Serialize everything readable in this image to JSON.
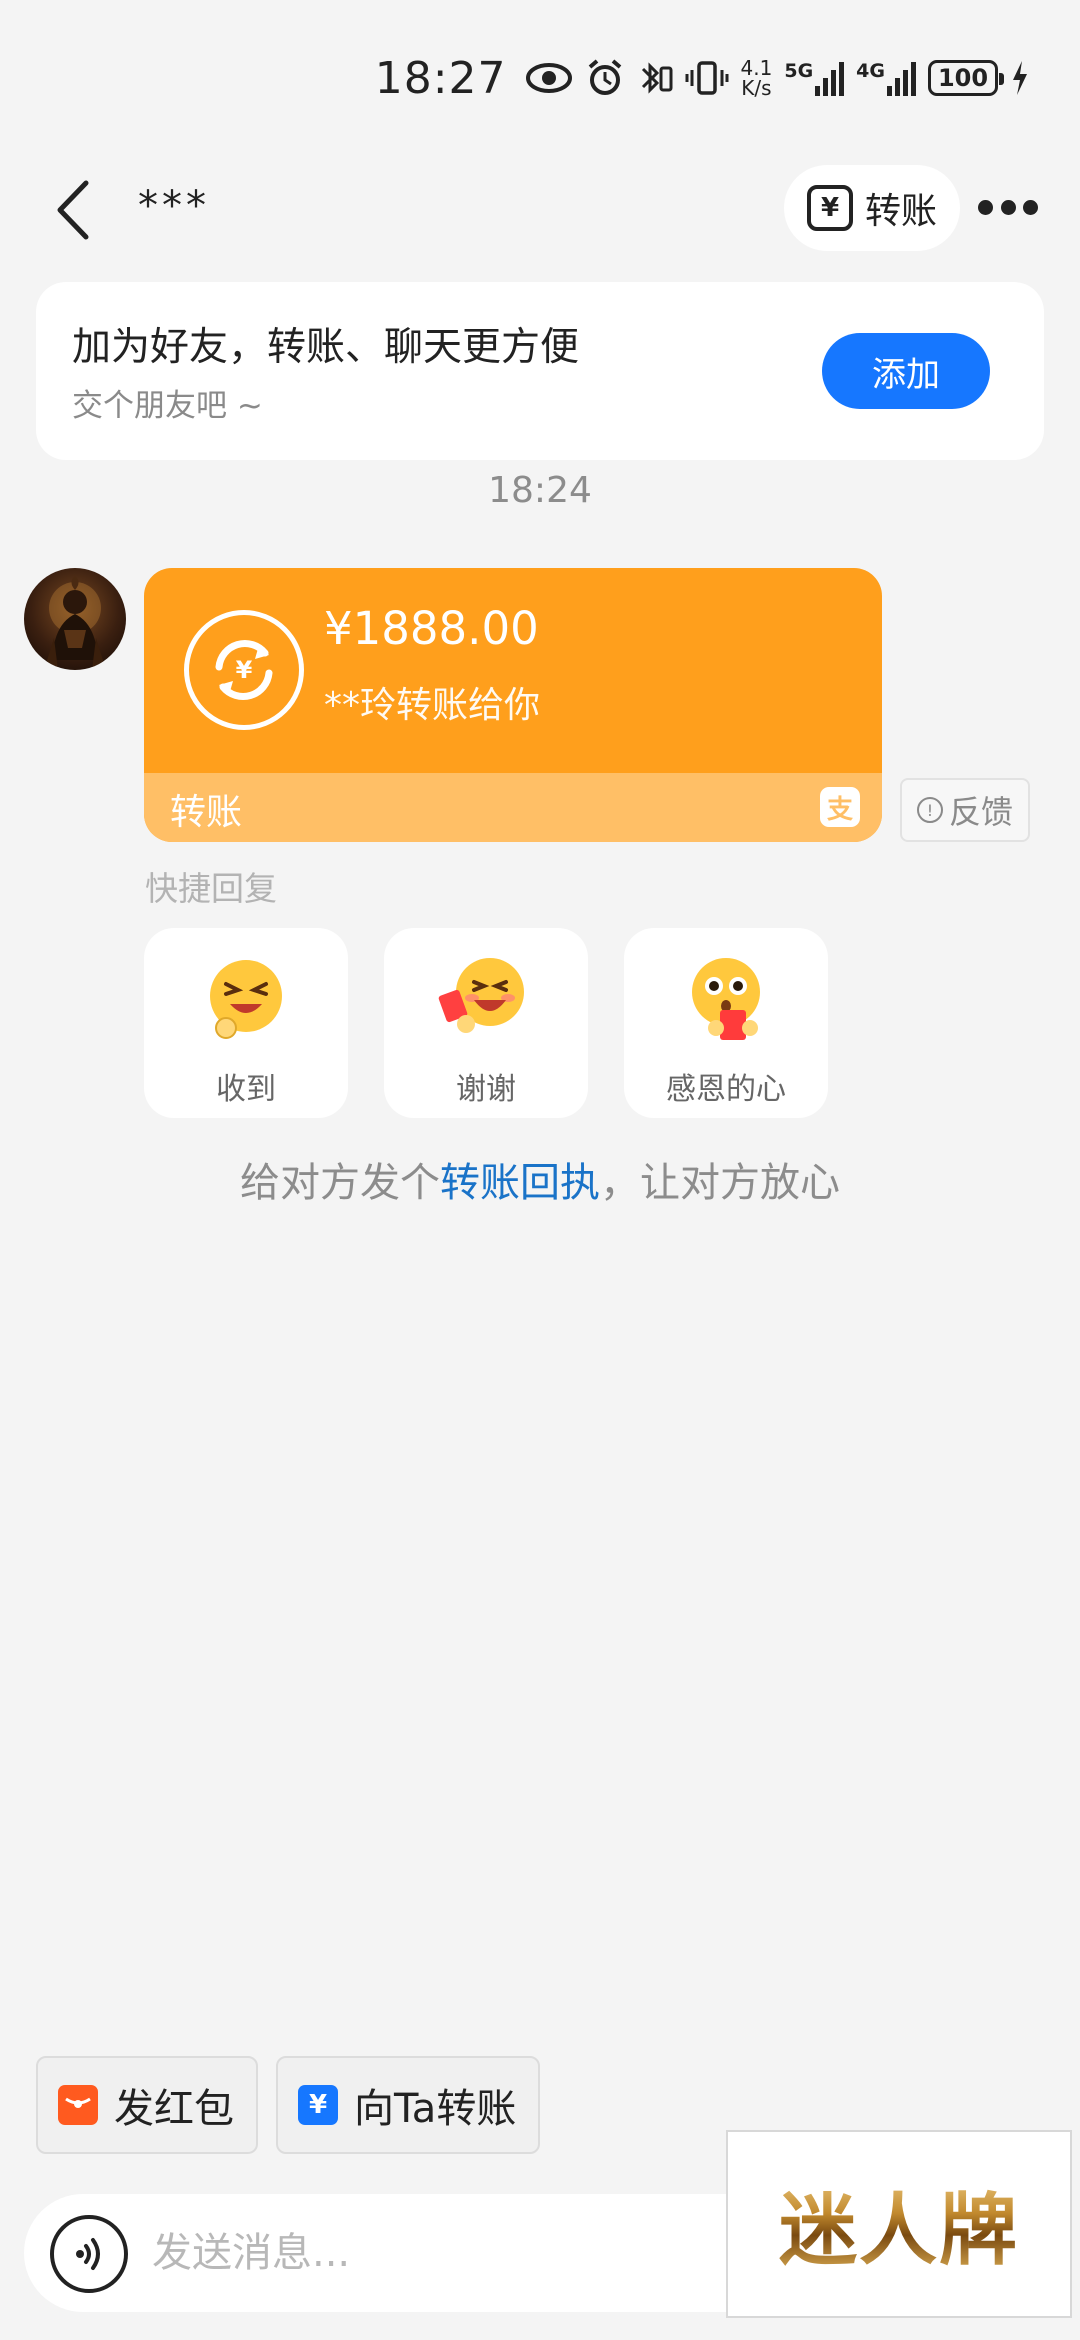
{
  "status_bar": {
    "time": "18:27",
    "net_speed_value": "4.1",
    "net_speed_unit": "K/s",
    "network_1": "5G",
    "network_2": "4G",
    "battery": "100"
  },
  "nav": {
    "title": "***",
    "transfer_label": "转账",
    "transfer_icon_glyph": "¥"
  },
  "friend_card": {
    "title": "加为好友，转账、聊天更方便",
    "subtitle": "交个朋友吧 ~",
    "add_label": "添加"
  },
  "chat": {
    "timestamp": "18:24",
    "transfer": {
      "amount": "¥1888.00",
      "description": "**玲转账给你",
      "label": "转账",
      "coin_glyph": "¥",
      "alipay_glyph": "支"
    },
    "feedback_label": "反馈",
    "feedback_glyph": "!",
    "quick_reply_title": "快捷回复",
    "quick_replies": [
      {
        "label": "收到"
      },
      {
        "label": "谢谢"
      },
      {
        "label": "感恩的心"
      }
    ],
    "receipt_hint_prefix": "给对方发个",
    "receipt_hint_link": "转账回执",
    "receipt_hint_suffix": "，让对方放心"
  },
  "bottom": {
    "red_packet_label": "发红包",
    "transfer_to_label": "向Ta转账",
    "transfer_to_glyph": "¥",
    "input_placeholder": "发送消息..."
  },
  "watermark": {
    "text": "迷人牌"
  },
  "colors": {
    "accent_blue": "#1677ff",
    "transfer_orange": "#ff9f1c",
    "transfer_orange_light": "#ffbf66",
    "red_packet": "#ff5a1f",
    "background": "#f4f4f4"
  }
}
